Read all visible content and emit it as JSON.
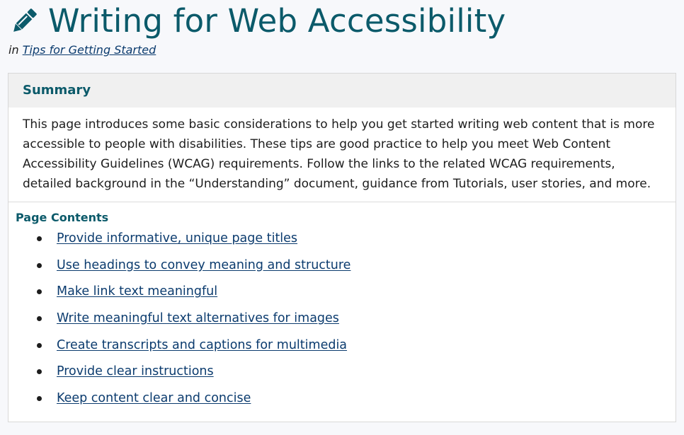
{
  "header": {
    "title": "Writing for Web Accessibility",
    "breadcrumb_prefix": "in",
    "breadcrumb_link": "Tips for Getting Started"
  },
  "summary": {
    "heading": "Summary",
    "text": "This page introduces some basic considerations to help you get started writing web content that is more accessible to people with disabilities. These tips are good practice to help you meet Web Content Accessibility Guidelines (WCAG) requirements. Follow the links to the related WCAG requirements, detailed background in the “Understanding” document, guidance from Tutorials, user stories, and more."
  },
  "contents": {
    "heading": "Page Contents",
    "items": [
      {
        "label": "Provide informative, unique page titles"
      },
      {
        "label": "Use headings to convey meaning and structure"
      },
      {
        "label": "Make link text meaningful"
      },
      {
        "label": "Write meaningful text alternatives for images"
      },
      {
        "label": "Create transcripts and captions for multimedia"
      },
      {
        "label": "Provide clear instructions"
      },
      {
        "label": "Keep content clear and concise"
      }
    ]
  },
  "colors": {
    "accent": "#0b5a6a",
    "link": "#0b3b6e",
    "panel_header": "#f0f0f0"
  },
  "icons": {
    "title_icon": "pencil-icon"
  }
}
